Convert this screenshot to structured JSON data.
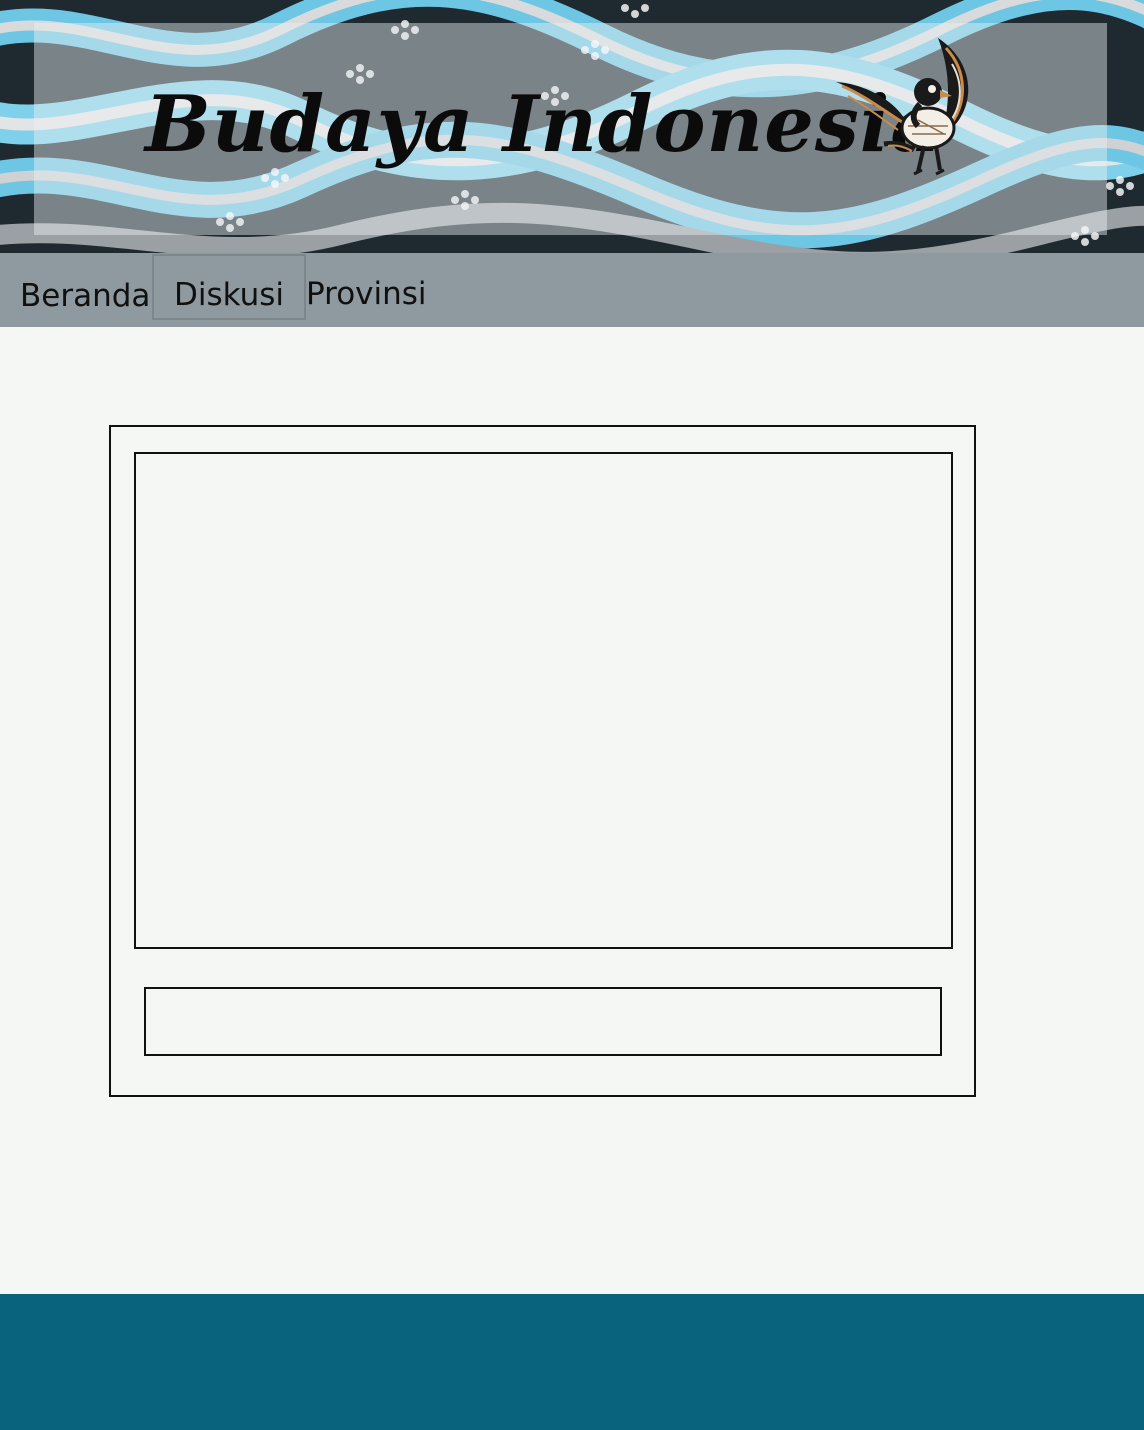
{
  "header": {
    "title": "Budaya Indonesia",
    "logo_icon": "garuda-bird-icon",
    "pattern_colors": [
      "#6cc6e4",
      "#d9dadb",
      "#1b1f23",
      "#9aa0a4"
    ]
  },
  "nav": {
    "items": [
      {
        "label": "Beranda"
      },
      {
        "label": "Diskusi",
        "active": true
      },
      {
        "label": "Provinsi"
      }
    ],
    "background": "#8f9aa0"
  },
  "discussion": {
    "message_area_value": "",
    "input_value": ""
  },
  "footer": {
    "background": "#0a637c"
  }
}
